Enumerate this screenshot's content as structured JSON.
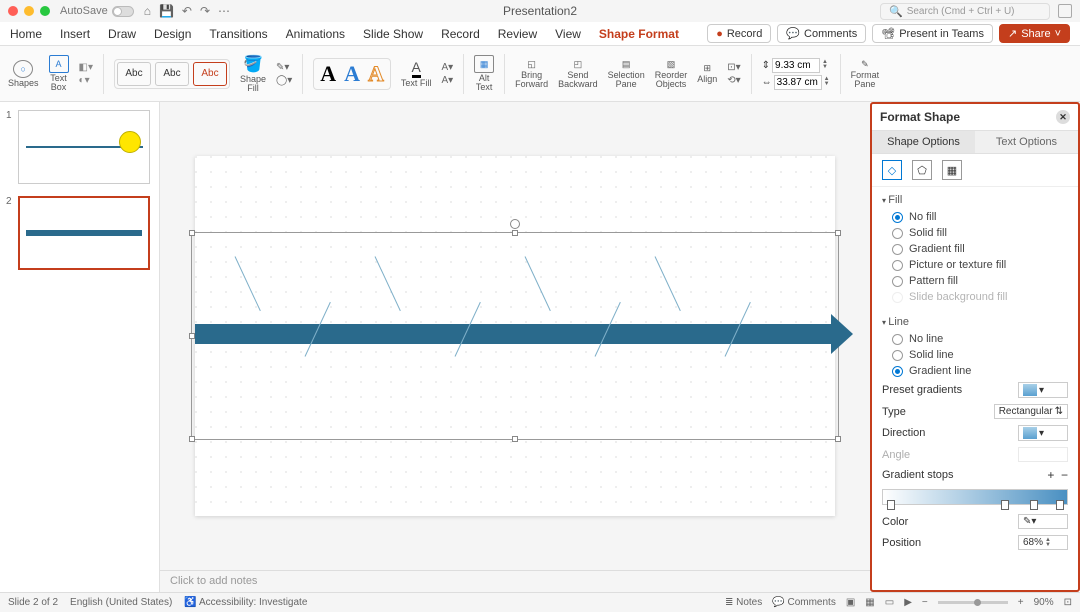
{
  "titlebar": {
    "autosave": "AutoSave",
    "document_title": "Presentation2",
    "search_placeholder": "Search (Cmd + Ctrl + U)"
  },
  "tabs": {
    "items": [
      "Home",
      "Insert",
      "Draw",
      "Design",
      "Transitions",
      "Animations",
      "Slide Show",
      "Record",
      "Review",
      "View",
      "Shape Format"
    ],
    "active_index": 10,
    "record": "Record",
    "comments": "Comments",
    "present": "Present in Teams",
    "share": "Share"
  },
  "ribbon": {
    "shapes": "Shapes",
    "textbox": "Text\nBox",
    "style_label": "Abc",
    "shape_fill": "Shape\nFill",
    "text_fill": "Text Fill",
    "alt_text": "Alt\nText",
    "bring_forward": "Bring\nForward",
    "send_backward": "Send\nBackward",
    "selection_pane": "Selection\nPane",
    "reorder_objects": "Reorder\nObjects",
    "align": "Align",
    "width": "9.33 cm",
    "height": "33.87 cm",
    "format_pane": "Format\nPane"
  },
  "thumbs": {
    "count": 2,
    "selected": 2
  },
  "notes_placeholder": "Click to add notes",
  "pane": {
    "title": "Format Shape",
    "shape_options": "Shape Options",
    "text_options": "Text Options",
    "fill_section": "Fill",
    "fill_options": [
      "No fill",
      "Solid fill",
      "Gradient fill",
      "Picture or texture fill",
      "Pattern fill",
      "Slide background fill"
    ],
    "fill_selected": 0,
    "line_section": "Line",
    "line_options": [
      "No line",
      "Solid line",
      "Gradient line"
    ],
    "line_selected": 2,
    "preset_gradients": "Preset gradients",
    "type_label": "Type",
    "type_value": "Rectangular",
    "direction": "Direction",
    "angle": "Angle",
    "gradient_stops": "Gradient stops",
    "color": "Color",
    "position": "Position",
    "position_value": "68%"
  },
  "status": {
    "slide_info": "Slide 2 of 2",
    "language": "English (United States)",
    "accessibility": "Accessibility: Investigate",
    "notes": "Notes",
    "comments": "Comments",
    "zoom": "90%"
  }
}
